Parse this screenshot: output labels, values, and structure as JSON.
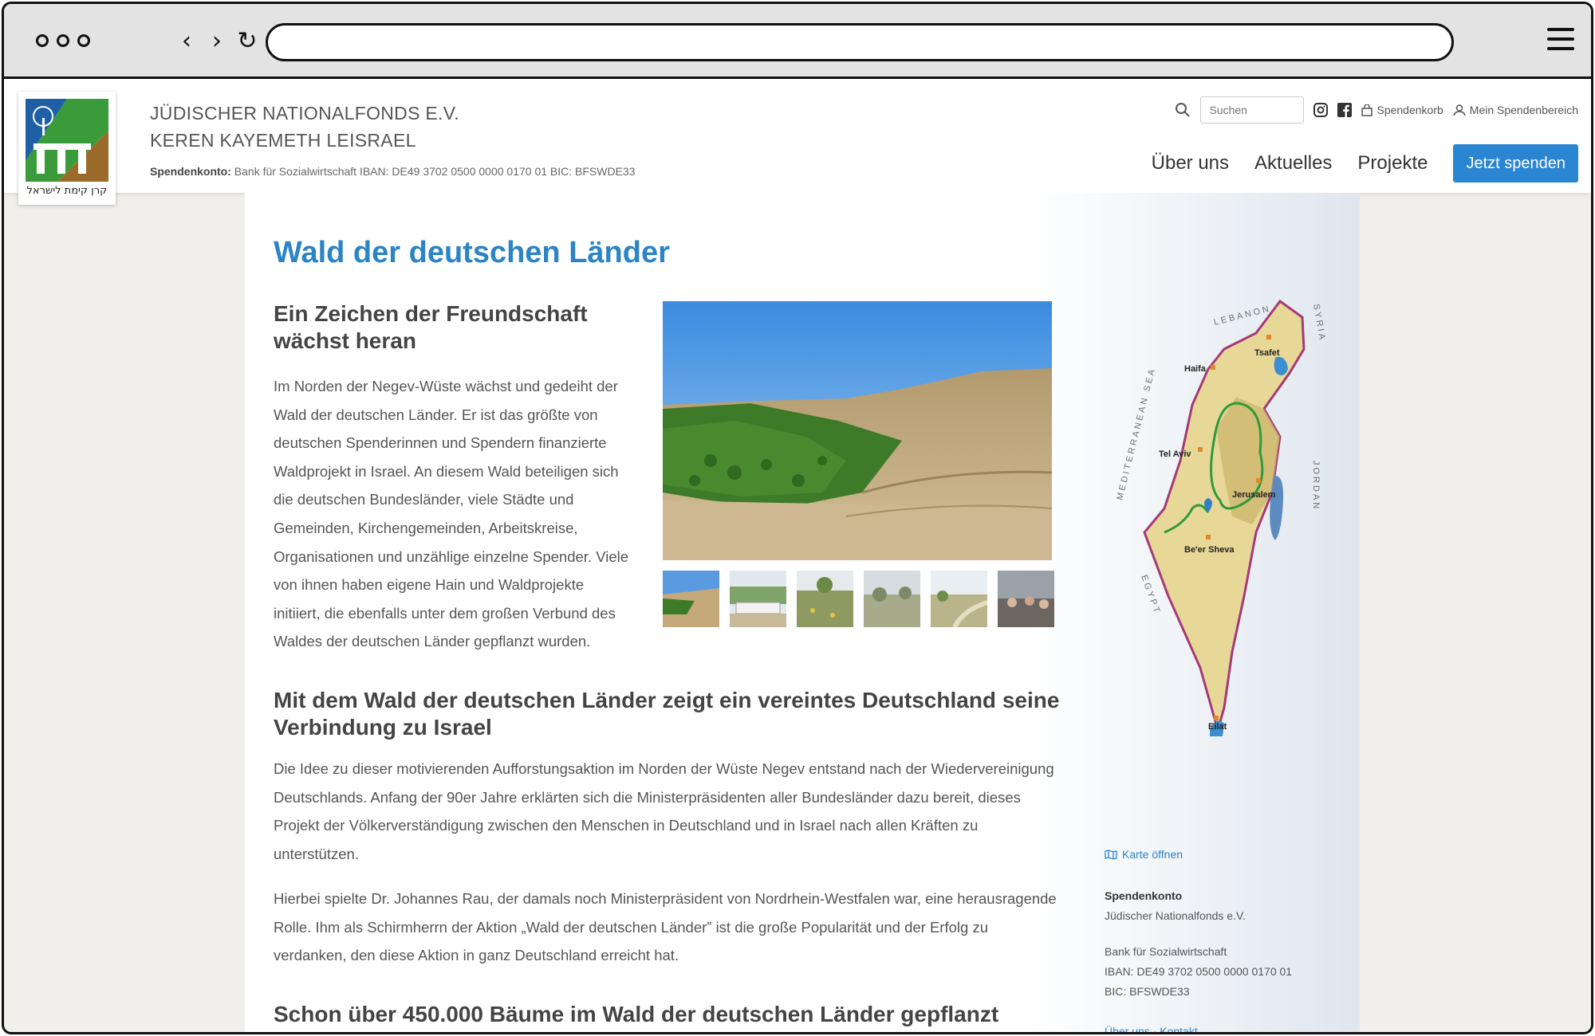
{
  "browser": {
    "url": ""
  },
  "header": {
    "logo_caption": "קרן קימת לישראל",
    "org_line1": "JÜDISCHER NATIONALFONDS E.V.",
    "org_line2": "KEREN KAYEMETH LEISRAEL",
    "bank_label": "Spendenkonto:",
    "bank_text": " Bank für Sozialwirtschaft    IBAN: DE49 3702 0500 0000 0170 01    BIC: BFSWDE33",
    "search_placeholder": "Suchen",
    "spendenkorb": "Spendenkorb",
    "mein_spendenbereich": "Mein Spendenbereich",
    "nav": [
      "Über uns",
      "Aktuelles",
      "Projekte"
    ],
    "donate": "Jetzt spenden"
  },
  "content": {
    "title": "Wald der deutschen Länder",
    "h2a": "Ein Zeichen der Freundschaft wächst heran",
    "para1": "Im Norden der Negev-Wüste wächst und gedeiht der Wald der deutschen Länder. Er ist das größte von deutschen Spenderinnen und Spendern finanzierte Waldprojekt in Israel. An diesem Wald beteiligen sich die deutschen Bundesländer, viele Städte und Gemeinden, Kirchengemeinden, Arbeitskreise, Organisationen und unzählige einzelne Spender. Viele von ihnen haben eigene Hain und Waldprojekte initiiert, die ebenfalls unter dem großen Verbund des Waldes der deutschen Länder gepflanzt wurden.",
    "h2b": "Mit dem Wald der deutschen Länder zeigt ein vereintes Deutschland seine Verbindung zu Israel",
    "para2": "Die Idee zu dieser motivierenden Aufforstungsaktion im Norden der Wüste Negev entstand nach der Wiedervereinigung Deutschlands. Anfang der 90er Jahre erklärten sich die Ministerpräsidenten aller Bundesländer dazu bereit, dieses Projekt der Völkerverständigung zwischen den Menschen in Deutschland und in Israel nach allen Kräften zu unterstützen.",
    "para3": "Hierbei spielte Dr. Johannes Rau, der damals noch Ministerpräsident von Nordrhein-Westfalen war, eine herausragende Rolle. Ihm als Schirmherrn der Aktion „Wald der deutschen Länder” ist die große Popularität und der Erfolg zu verdanken, den diese Aktion in ganz Deutschland erreicht hat.",
    "h2c": "Schon über 450.000 Bäume im Wald der deutschen Länder gepflanzt"
  },
  "map": {
    "labels": {
      "lebanon": "LEBANON",
      "syria": "SYRIA",
      "sea": "MEDITERRANEAN SEA",
      "jordan": "JORDAN",
      "egypt": "EGYPT",
      "tsafet": "Tsafet",
      "haifa": "Haifa",
      "telaviv": "Tel Aviv",
      "jerusalem": "Jerusalem",
      "beersheva": "Be'er Sheva",
      "eilat": "Eilat"
    }
  },
  "sidebar": {
    "karte_link": "Karte öffnen",
    "konto_heading": "Spendenkonto",
    "line1": "Jüdischer Nationalfonds e.V.",
    "line2": "Bank für Sozialwirtschaft",
    "line3": "IBAN: DE49 3702 0500 0000 0170 01",
    "line4": "BIC: BFSWDE33",
    "contact": "Über uns · Kontakt"
  }
}
